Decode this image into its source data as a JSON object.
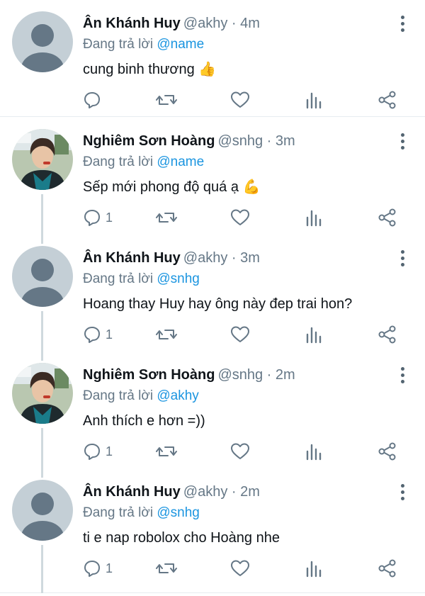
{
  "tweets": [
    {
      "name": "Ân Khánh Huy",
      "handle": "@akhy · 4m",
      "replying_prefix": "Đang trả lời ",
      "replying_to": "@name",
      "text": "cung binh thương",
      "emoji": "👍",
      "avatar": "default-avatar",
      "reply_count": ""
    },
    {
      "name": "Nghiêm Sơn Hoàng",
      "handle": "@snhg · 3m",
      "replying_prefix": "Đang trả lời ",
      "replying_to": "@name",
      "text": "Sếp mới phong độ quá ạ",
      "emoji": "💪",
      "avatar": "photo-avatar",
      "reply_count": "1"
    },
    {
      "name": "Ân Khánh Huy",
      "handle": "@akhy · 3m",
      "replying_prefix": "Đang trả lời ",
      "replying_to": "@snhg",
      "text": "Hoang thay Huy hay ông này đep trai hon?",
      "emoji": "",
      "avatar": "default-avatar",
      "reply_count": "1"
    },
    {
      "name": "Nghiêm Sơn Hoàng",
      "handle": "@snhg · 2m",
      "replying_prefix": "Đang trả lời ",
      "replying_to": "@akhy",
      "text": "Anh thích e hơn =))",
      "emoji": "",
      "avatar": "photo-avatar",
      "reply_count": "1"
    },
    {
      "name": "Ân Khánh Huy",
      "handle": "@akhy · 2m",
      "replying_prefix": "Đang trả lời ",
      "replying_to": "@snhg",
      "text": "ti e nap robolox cho Hoàng nhe",
      "emoji": "",
      "avatar": "default-avatar",
      "reply_count": "1"
    }
  ],
  "icons": {
    "reply": "reply-icon",
    "retweet": "retweet-icon",
    "like": "heart-icon",
    "analytics": "analytics-icon",
    "share": "share-icon",
    "more": "more-icon"
  },
  "colors": {
    "mention": "#1b95e0",
    "secondary_text": "#657786",
    "separator": "#e6ecf0",
    "thread_line": "#cfd9de"
  }
}
